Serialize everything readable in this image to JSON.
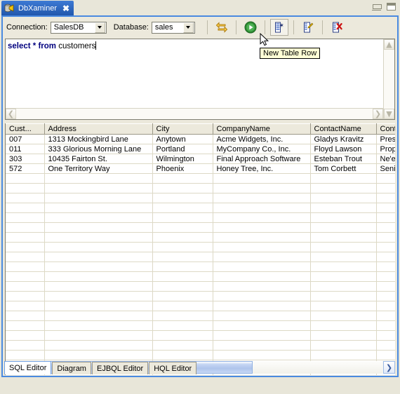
{
  "window": {
    "tab_title": "DbXaminer",
    "tab_close_label": "✖",
    "app_icon": "database-icon",
    "minimize_label": "minimize-icon",
    "maximize_label": "maximize-icon"
  },
  "toolbar": {
    "connection_label": "Connection:",
    "connection_value": "SalesDB",
    "database_label": "Database:",
    "database_value": "sales",
    "buttons": [
      {
        "name": "commit-rollback-icon",
        "title": "Commit"
      },
      {
        "name": "run-query-icon",
        "title": "Execute"
      },
      {
        "name": "new-table-row-icon",
        "title": "New Table Row"
      },
      {
        "name": "edit-table-row-icon",
        "title": "Edit Table Row"
      },
      {
        "name": "delete-table-row-icon",
        "title": "Delete Table Row"
      }
    ]
  },
  "tooltip": {
    "text": "New Table Row"
  },
  "editor": {
    "keyword_text": "select * from",
    "identifier_text": "customers"
  },
  "grid": {
    "columns": [
      "Cust...",
      "Address",
      "City",
      "CompanyName",
      "ContactName",
      "Cont..."
    ],
    "rows": [
      [
        "007",
        "1313 Mockingbird Lane",
        "Anytown",
        "Acme Widgets, Inc.",
        "Gladys Kravitz",
        "Presi..."
      ],
      [
        "011",
        "333 Glorious Morning Lane",
        "Portland",
        "MyCompany Co., Inc.",
        "Floyd Lawson",
        "Propr..."
      ],
      [
        "303",
        "10435 Fairton St.",
        "Wilmington",
        "Final Approach Software",
        "Esteban Trout",
        "Ne'er..."
      ],
      [
        "572",
        "One Territory Way",
        "Phoenix",
        "Honey Tree, Inc.",
        "Tom Corbett",
        "Senio..."
      ]
    ],
    "empty_row_count": 21
  },
  "bottom_tabs": [
    {
      "label": "SQL Editor",
      "active": true
    },
    {
      "label": "Diagram",
      "active": false
    },
    {
      "label": "EJBQL Editor",
      "active": false
    },
    {
      "label": "HQL Editor",
      "active": false
    }
  ],
  "colors": {
    "tab_blue": "#2e64b8",
    "panel_border": "#4a8ae0",
    "chrome": "#ece9dc",
    "keyword": "#00007f",
    "scroll_thumb": "#aec4ec"
  }
}
